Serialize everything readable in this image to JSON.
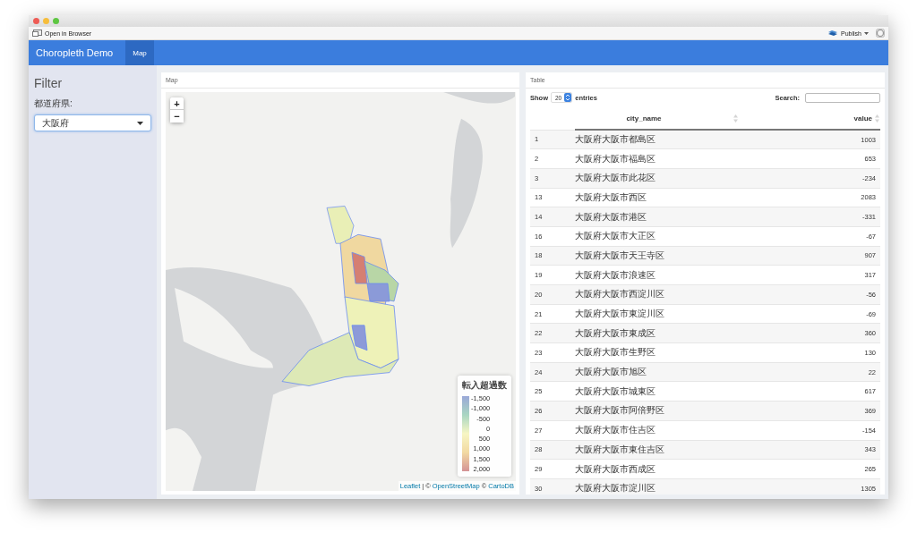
{
  "toolbar": {
    "open_label": "Open in Browser",
    "publish_label": "Publish"
  },
  "navbar": {
    "brand": "Choropleth Demo",
    "tabs": [
      {
        "label": "Map",
        "selected": true
      }
    ]
  },
  "sidebar": {
    "heading": "Filter",
    "field_label": "都道府県:",
    "select_value": "大阪府"
  },
  "map_panel": {
    "title": "Map",
    "zoom_in": "+",
    "zoom_out": "−",
    "legend": {
      "title": "転入超過数",
      "ticks": [
        "-1,500",
        "-1,000",
        "-500",
        "0",
        "500",
        "1,000",
        "1,500",
        "2,000"
      ]
    },
    "attribution": [
      {
        "text": "Leaflet",
        "link": true
      },
      {
        "text": "|",
        "link": false
      },
      {
        "text": "©",
        "link": false
      },
      {
        "text": "OpenStreetMap",
        "link": true
      },
      {
        "text": "©",
        "link": false
      },
      {
        "text": "CartoDB",
        "link": true
      }
    ]
  },
  "table_panel": {
    "title": "Table",
    "show_label": "Show",
    "page_size": "20",
    "entries_label": "entries",
    "search_label": "Search:",
    "columns": [
      {
        "label": "city_name"
      },
      {
        "label": "value"
      }
    ],
    "rows": [
      {
        "index": "1",
        "city_name": "大阪府大阪市都島区",
        "value": "1003"
      },
      {
        "index": "2",
        "city_name": "大阪府大阪市福島区",
        "value": "653"
      },
      {
        "index": "3",
        "city_name": "大阪府大阪市此花区",
        "value": "-234"
      },
      {
        "index": "13",
        "city_name": "大阪府大阪市西区",
        "value": "2083"
      },
      {
        "index": "14",
        "city_name": "大阪府大阪市港区",
        "value": "-331"
      },
      {
        "index": "16",
        "city_name": "大阪府大阪市大正区",
        "value": "-67"
      },
      {
        "index": "18",
        "city_name": "大阪府大阪市天王寺区",
        "value": "907"
      },
      {
        "index": "19",
        "city_name": "大阪府大阪市浪速区",
        "value": "317"
      },
      {
        "index": "20",
        "city_name": "大阪府大阪市西淀川区",
        "value": "-56"
      },
      {
        "index": "21",
        "city_name": "大阪府大阪市東淀川区",
        "value": "-69"
      },
      {
        "index": "22",
        "city_name": "大阪府大阪市東成区",
        "value": "360"
      },
      {
        "index": "23",
        "city_name": "大阪府大阪市生野区",
        "value": "130"
      },
      {
        "index": "24",
        "city_name": "大阪府大阪市旭区",
        "value": "22"
      },
      {
        "index": "25",
        "city_name": "大阪府大阪市城東区",
        "value": "617"
      },
      {
        "index": "26",
        "city_name": "大阪府大阪市阿倍野区",
        "value": "369"
      },
      {
        "index": "27",
        "city_name": "大阪府大阪市住吉区",
        "value": "-154"
      },
      {
        "index": "28",
        "city_name": "大阪府大阪市東住吉区",
        "value": "343"
      },
      {
        "index": "29",
        "city_name": "大阪府大阪市西成区",
        "value": "265"
      },
      {
        "index": "30",
        "city_name": "大阪府大阪市淀川区",
        "value": "1305"
      }
    ]
  }
}
